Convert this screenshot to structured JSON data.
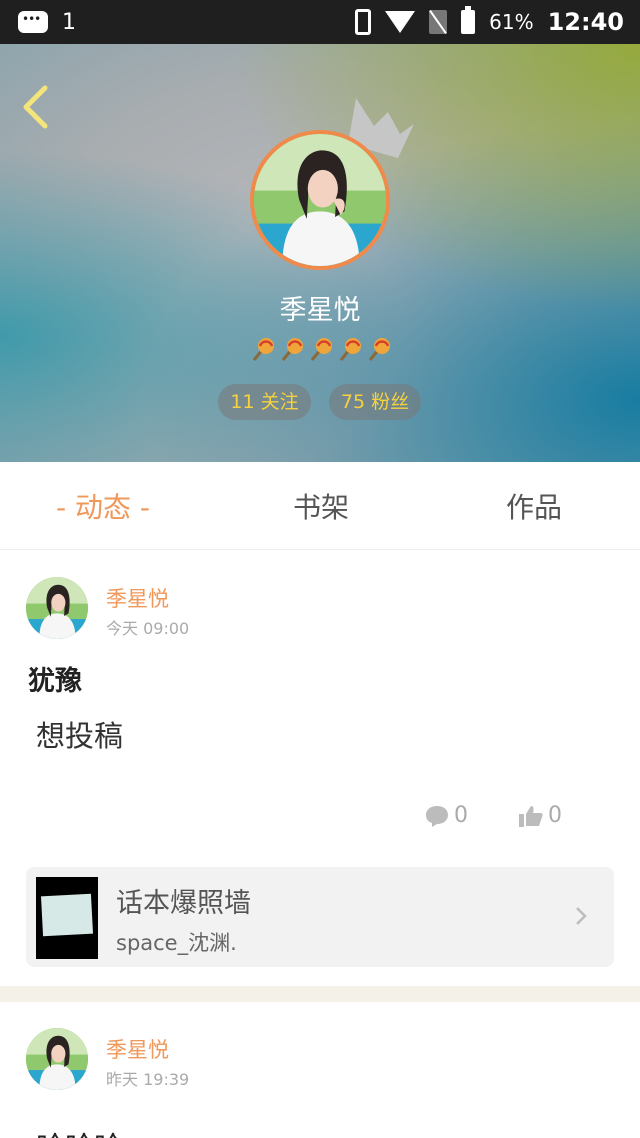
{
  "status_bar": {
    "notification_count": "1",
    "battery": "61%",
    "time": "12:40",
    "icons": [
      "message-icon",
      "vibrate-icon",
      "wifi-icon",
      "no-sim-icon",
      "battery-icon"
    ]
  },
  "profile": {
    "name": "季星悦",
    "badge_count": 5,
    "follow_label": "11 关注",
    "fans_label": "75 粉丝",
    "accent_color": "#f0975a"
  },
  "tabs": [
    {
      "label": "- 动态 -",
      "active": true
    },
    {
      "label": "书架",
      "active": false
    },
    {
      "label": "作品",
      "active": false
    }
  ],
  "posts": [
    {
      "author": "季星悦",
      "time": "今天 09:00",
      "title": "犹豫",
      "body": "想投稿",
      "comments": "0",
      "likes": "0",
      "share": {
        "title": "话本爆照墙",
        "subtitle": "space_沈渊."
      }
    },
    {
      "author": "季星悦",
      "time": "昨天 19:39",
      "title": "哈哈哈"
    }
  ]
}
